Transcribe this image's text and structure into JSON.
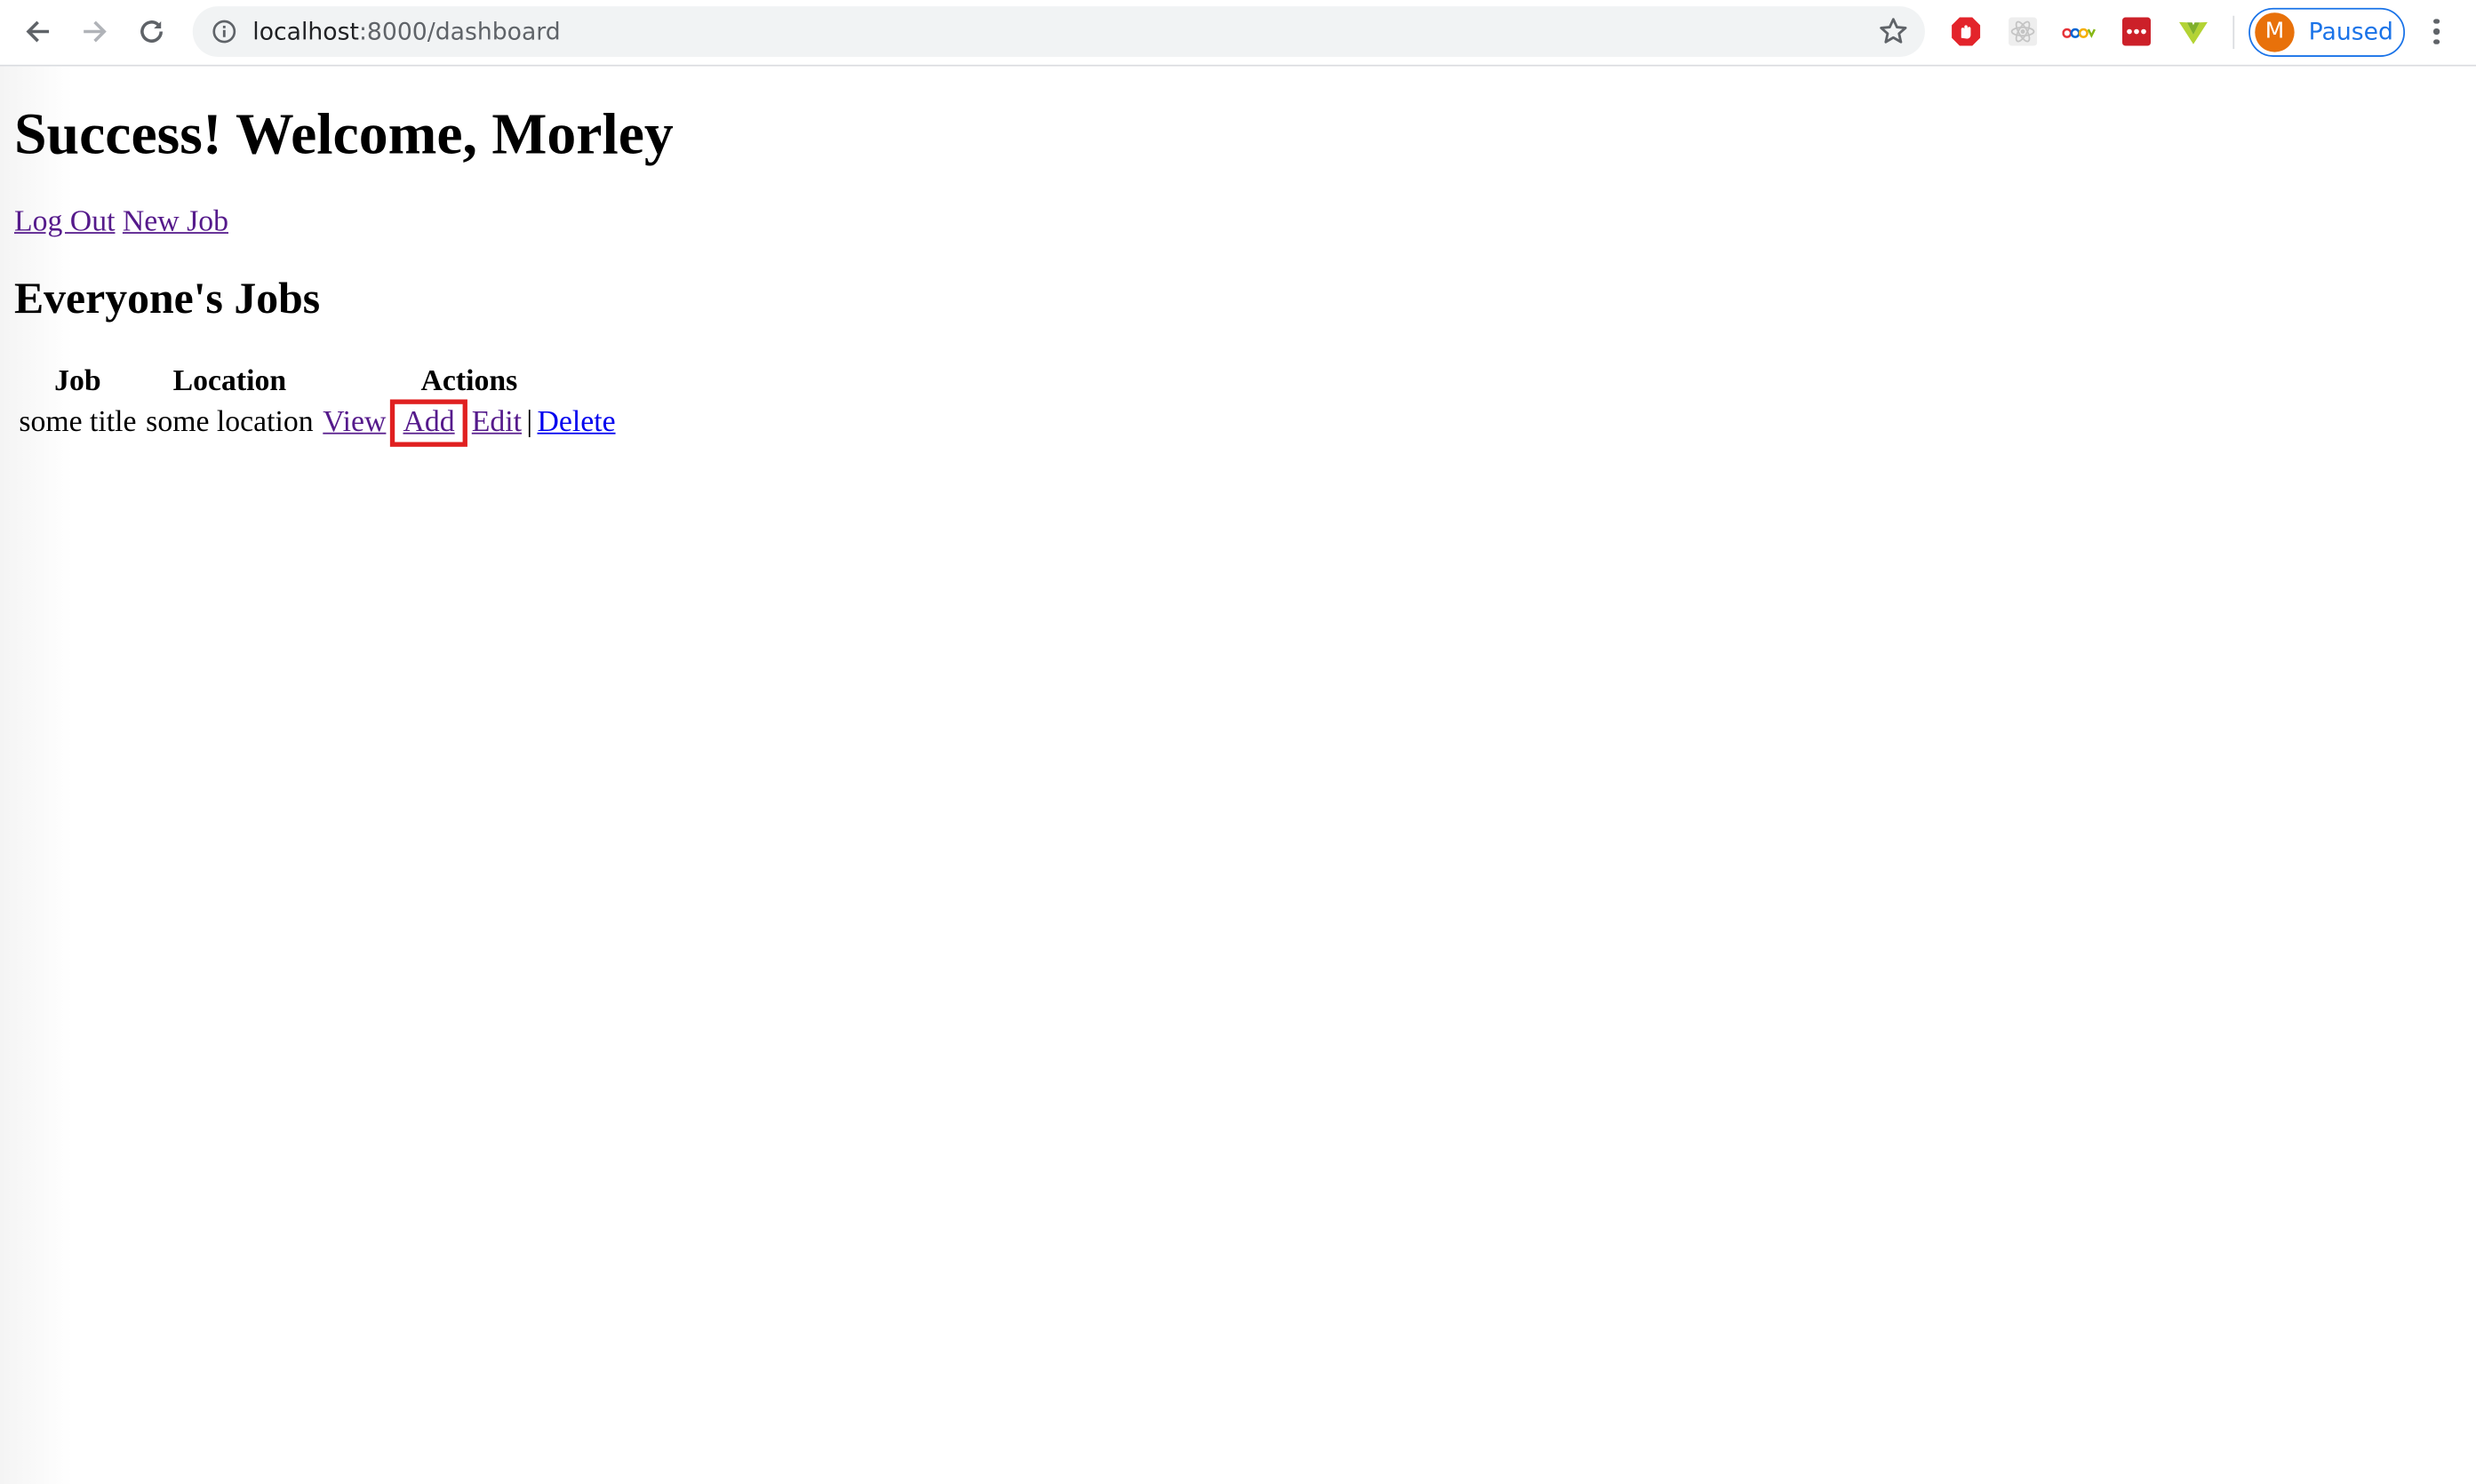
{
  "browser": {
    "url_host": "localhost",
    "url_path": ":8000/dashboard",
    "profile_initial": "M",
    "profile_status": "Paused",
    "extensions": [
      "adblock-icon",
      "react-devtools-icon",
      "ebay-icon",
      "lastpass-icon",
      "vue-devtools-icon"
    ],
    "accent_color": "#1a73e8"
  },
  "page": {
    "title": "Success! Welcome, Morley",
    "nav": {
      "logout_label": "Log Out",
      "new_job_label": "New Job"
    },
    "section_title": "Everyone's Jobs",
    "table": {
      "headers": [
        "Job",
        "Location",
        "Actions"
      ],
      "rows": [
        {
          "job": "some title",
          "location": "some location",
          "actions": {
            "view": "View",
            "add": "Add",
            "edit": "Edit",
            "separator": "|",
            "delete": "Delete"
          }
        }
      ]
    },
    "highlight_color": "#e02020"
  }
}
